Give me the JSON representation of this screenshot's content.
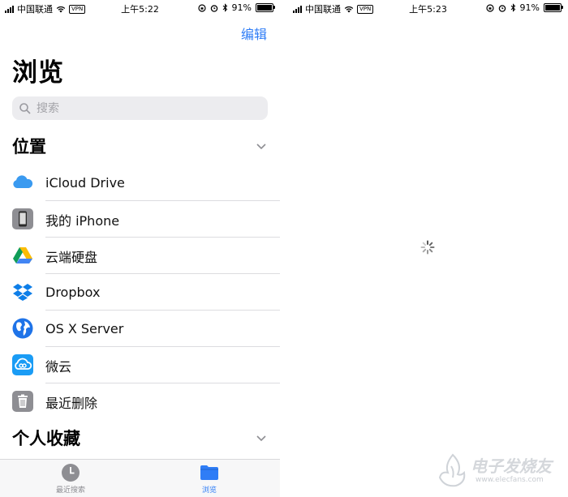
{
  "left": {
    "status": {
      "carrier": "中国联通",
      "vpn": "VPN",
      "time": "上午5:22",
      "battery": "91%"
    },
    "edit_label": "编辑",
    "title": "浏览",
    "search_placeholder": "搜索",
    "locations_header": "位置",
    "locations": [
      {
        "label": "iCloud Drive",
        "icon": "icloud-icon"
      },
      {
        "label": "我的 iPhone",
        "icon": "iphone-icon"
      },
      {
        "label": "云端硬盘",
        "icon": "google-drive-icon"
      },
      {
        "label": "Dropbox",
        "icon": "dropbox-icon"
      },
      {
        "label": "OS X Server",
        "icon": "globe-icon"
      },
      {
        "label": "微云",
        "icon": "weiyun-icon"
      },
      {
        "label": "最近删除",
        "icon": "trash-icon"
      }
    ],
    "favorites_header": "个人收藏",
    "tabs": {
      "recent": "最近搜索",
      "browse": "浏览"
    }
  },
  "right": {
    "status": {
      "carrier": "中国联通",
      "vpn": "VPN",
      "time": "上午5:23",
      "battery": "91%"
    }
  },
  "watermark": {
    "text": "电子发烧友",
    "url": "www.elecfans.com"
  },
  "colors": {
    "accent": "#2f7df6",
    "search_bg": "#ececef"
  }
}
